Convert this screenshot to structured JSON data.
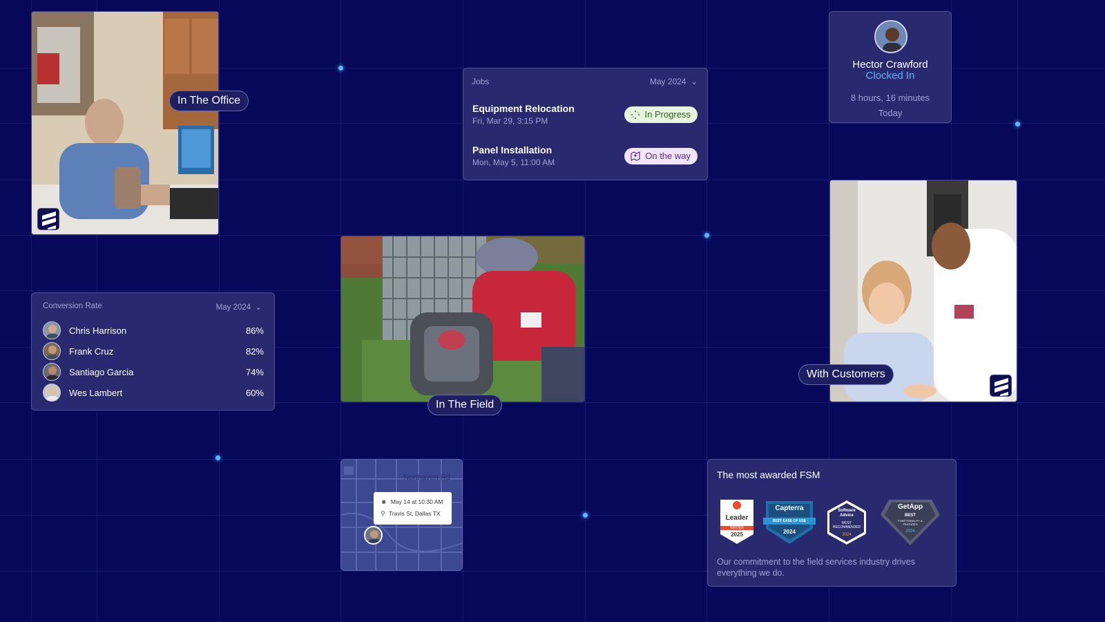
{
  "labels": {
    "office": "In The Office",
    "field": "In The Field",
    "customers": "With Customers"
  },
  "jobs": {
    "title": "Jobs",
    "month": "May 2024",
    "items": [
      {
        "name": "Equipment Relocation",
        "date": "Fri, Mar 29, 3:15 PM",
        "status": "In Progress"
      },
      {
        "name": "Panel Installation",
        "date": "Mon, May 5, 11:00 AM",
        "status": "On the way"
      }
    ]
  },
  "profile": {
    "name": "Hector Crawford",
    "status": "Clocked In",
    "duration": "8 hours, 16 minutes",
    "when": "Today"
  },
  "conversion": {
    "title": "Conversion Rate",
    "month": "May 2024",
    "rows": [
      {
        "name": "Chris Harrison",
        "pct": "86%"
      },
      {
        "name": "Frank Cruz",
        "pct": "82%"
      },
      {
        "name": "Santiago Garcia",
        "pct": "74%"
      },
      {
        "name": "Wes Lambert",
        "pct": "60%"
      }
    ]
  },
  "map": {
    "street": "Northaven Rd",
    "appointment": "May 14 at 10:30 AM",
    "address": "Travis St, Dallas TX"
  },
  "awards": {
    "title": "The most awarded FSM",
    "badges": {
      "g2_leader": "Leader",
      "g2_season": "WINTER",
      "g2_year": "2025",
      "capterra_name": "Capterra",
      "capterra_ribbon": "BEST EASE OF USE",
      "capterra_year": "2024",
      "sa_name": "Software Advice",
      "sa_label": "MOST RECOMMENDED",
      "sa_year": "2024",
      "getapp_name": "GetApp",
      "getapp_best": "BEST",
      "getapp_sub": "FUNCTIONALITY & FEATURES",
      "getapp_year": "2024"
    },
    "description": "Our commitment to the field services industry drives everything we do."
  },
  "colors": {
    "background": "#07085a",
    "card": "#28296e",
    "accent_clocked": "#5fb4ff",
    "dot": "#5ab4ff"
  }
}
